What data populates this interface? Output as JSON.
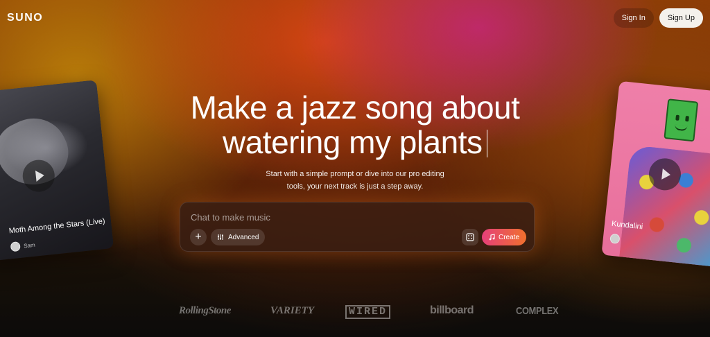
{
  "header": {
    "logo": "SUNO",
    "sign_in": "Sign In",
    "sign_up": "Sign Up"
  },
  "cards": {
    "left": {
      "title": "Moth Among the Stars (Live)",
      "author": "Sam"
    },
    "right": {
      "title": "Kundalini",
      "author": ""
    }
  },
  "hero": {
    "line1": "Make a jazz song about",
    "line2": "watering my plants",
    "subtitle_line1": "Start with a simple prompt or dive into our pro editing",
    "subtitle_line2": "tools, your next track is just a step away."
  },
  "composer": {
    "placeholder": "Chat to make music",
    "add_label": "+",
    "advanced_label": "Advanced",
    "create_label": "Create"
  },
  "press": [
    "RollingStone",
    "VARIETY",
    "WIRED",
    "billboard",
    "COMPLEX"
  ],
  "colors": {
    "create_gradient_start": "#e5407a",
    "create_gradient_end": "#f0702e",
    "signup_bg": "#f4f1ec"
  }
}
